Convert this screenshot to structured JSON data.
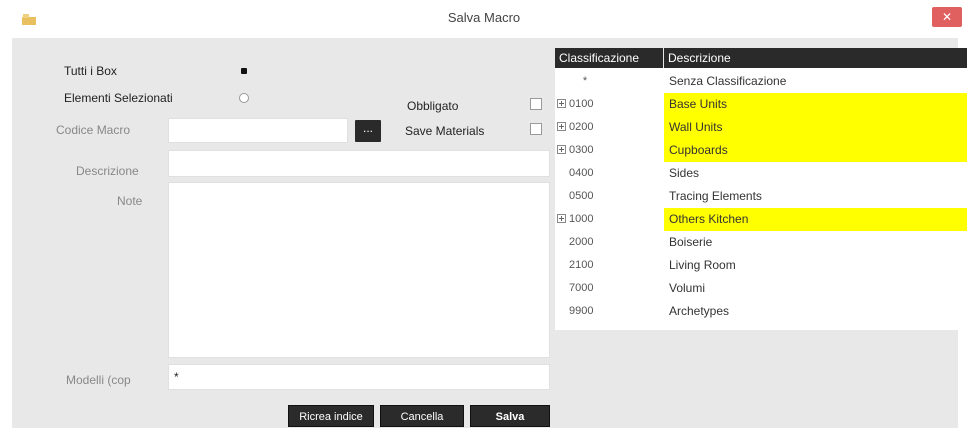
{
  "window": {
    "title": "Salva Macro",
    "app_icon": "macro-app-icon",
    "close_icon": "close-icon",
    "close_glyph": "✕"
  },
  "form": {
    "radio_all_boxes": {
      "label": "Tutti i Box",
      "checked": true
    },
    "radio_selected_elements": {
      "label": "Elementi Selezionati",
      "checked": false
    },
    "required": {
      "label": "Obbligato",
      "checked": false
    },
    "save_materials": {
      "label": "Save Materials",
      "checked": false
    },
    "macro_code": {
      "label": "Codice Macro",
      "value": ""
    },
    "browse_button": {
      "label": "..."
    },
    "description": {
      "label": "Descrizione",
      "value": ""
    },
    "notes": {
      "label": "Note",
      "value": ""
    },
    "copy_models": {
      "label": "Modelli (cop",
      "value": "*"
    }
  },
  "buttons": {
    "rebuild_index": "Ricrea indice",
    "cancel": "Cancella",
    "save": "Salva"
  },
  "table": {
    "headers": {
      "code": "Classificazione",
      "description": "Descrizione"
    },
    "rows": [
      {
        "code": "*",
        "description": "Senza Classificazione",
        "expandable": false,
        "highlight": false
      },
      {
        "code": "0100",
        "description": "Base Units",
        "expandable": true,
        "highlight": true
      },
      {
        "code": "0200",
        "description": "Wall Units",
        "expandable": true,
        "highlight": true
      },
      {
        "code": "0300",
        "description": "Cupboards",
        "expandable": true,
        "highlight": true
      },
      {
        "code": "0400",
        "description": "Sides",
        "expandable": false,
        "highlight": false
      },
      {
        "code": "0500",
        "description": "Tracing Elements",
        "expandable": false,
        "highlight": false
      },
      {
        "code": "1000",
        "description": "Others Kitchen",
        "expandable": true,
        "highlight": true
      },
      {
        "code": "2000",
        "description": "Boiserie",
        "expandable": false,
        "highlight": false
      },
      {
        "code": "2100",
        "description": "Living Room",
        "expandable": false,
        "highlight": false
      },
      {
        "code": "7000",
        "description": "Volumi",
        "expandable": false,
        "highlight": false
      },
      {
        "code": "9900",
        "description": "Archetypes",
        "expandable": false,
        "highlight": false
      }
    ]
  },
  "colors": {
    "highlight": "#ffff00",
    "header_bg": "#2a2a2a",
    "panel_bg": "#e8e8e8",
    "close_bg": "#e06060"
  }
}
